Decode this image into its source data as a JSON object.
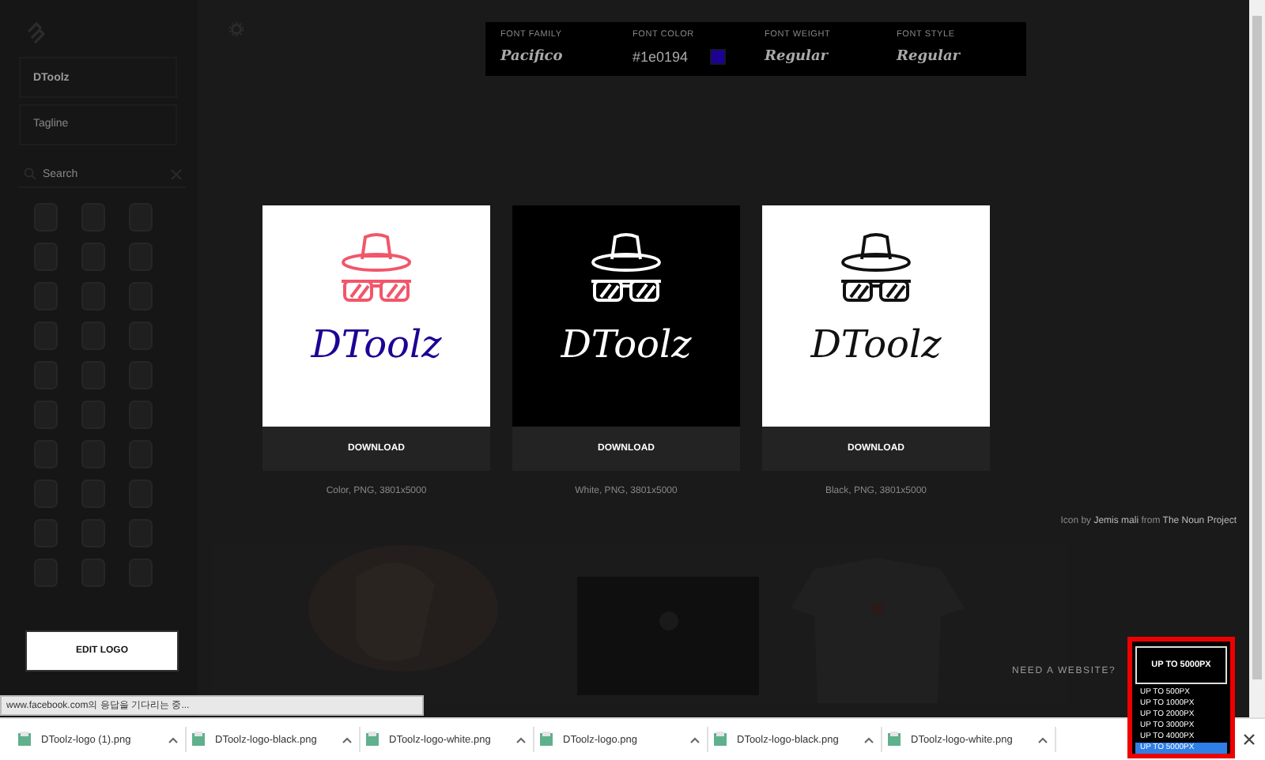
{
  "sidebar": {
    "name_value": "DToolz",
    "tagline_placeholder": "Tagline",
    "search_placeholder": "Search",
    "edit_button": "EDIT LOGO"
  },
  "font_bar": [
    {
      "label": "FONT FAMILY",
      "value": "Pacifico"
    },
    {
      "label": "FONT COLOR",
      "value": "#1e0194",
      "color": "#1e0194"
    },
    {
      "label": "FONT WEIGHT",
      "value": "Regular"
    },
    {
      "label": "FONT STYLE",
      "value": "Regular"
    }
  ],
  "logo_cards": [
    {
      "kind": "color",
      "logo_text": "DToolz",
      "button": "DOWNLOAD",
      "caption": "Color, PNG, 3801x5000"
    },
    {
      "kind": "white",
      "logo_text": "DToolz",
      "button": "DOWNLOAD",
      "caption": "White, PNG, 3801x5000"
    },
    {
      "kind": "black",
      "logo_text": "DToolz",
      "button": "DOWNLOAD",
      "caption": "Black, PNG, 3801x5000"
    }
  ],
  "credit": {
    "prefix": "Icon by",
    "author": "Jemis mali",
    "middle": "from",
    "source": "The Noun Project"
  },
  "website_prompt": "NEED A WEBSITE?",
  "size_select": {
    "value": "UP TO 5000PX",
    "options": [
      {
        "label": "UP TO 500PX",
        "selected": false
      },
      {
        "label": "UP TO 1000PX",
        "selected": false
      },
      {
        "label": "UP TO 2000PX",
        "selected": false
      },
      {
        "label": "UP TO 3000PX",
        "selected": false
      },
      {
        "label": "UP TO 4000PX",
        "selected": false
      },
      {
        "label": "UP TO 5000PX",
        "selected": true
      }
    ]
  },
  "status_text": "www.facebook.com의 응답을 기다리는 중...",
  "downloads": [
    "DToolz-logo (1).png",
    "DToolz-logo-black.png",
    "DToolz-logo-white.png",
    "DToolz-logo.png",
    "DToolz-logo-black.png",
    "DToolz-logo-white.png"
  ]
}
